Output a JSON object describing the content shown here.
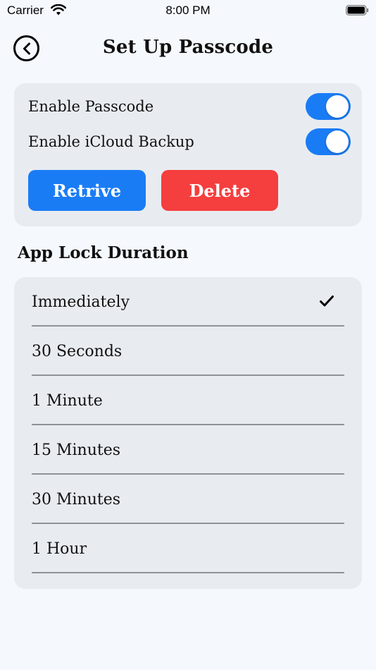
{
  "status_bar": {
    "carrier": "Carrier",
    "time": "8:00 PM"
  },
  "nav": {
    "title": "Set Up Passcode",
    "back_icon": "chevron-left-circle-icon"
  },
  "settings": {
    "enable_passcode_label": "Enable Passcode",
    "enable_passcode_on": true,
    "enable_icloud_label": "Enable iCloud Backup",
    "enable_icloud_on": true,
    "retrive_label": "Retrive",
    "delete_label": "Delete"
  },
  "lock_duration": {
    "title": "App Lock Duration",
    "selected": "Immediately",
    "options": [
      "Immediately",
      "30 Seconds",
      "1 Minute",
      "15 Minutes",
      "30 Minutes",
      "1 Hour"
    ]
  },
  "colors": {
    "accent": "#1a7cf5",
    "danger": "#f53e3e",
    "card": "#e8ecf1",
    "background": "#f5f9fe"
  }
}
